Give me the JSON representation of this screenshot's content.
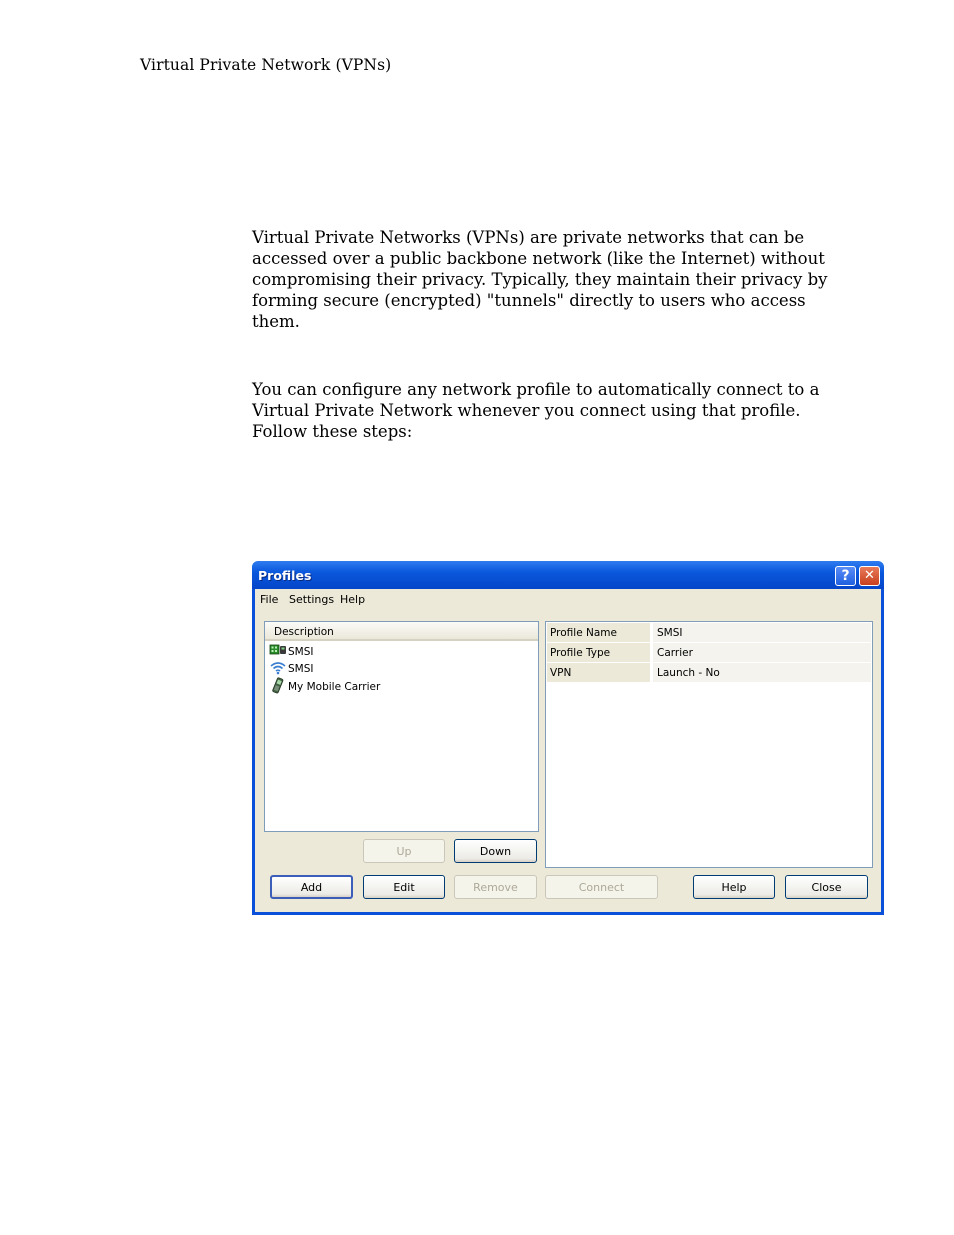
{
  "page": {
    "running_header": "Virtual Private Network (VPNs)",
    "paragraph_1": "Virtual Private Networks (VPNs) are private networks that can be accessed over a public backbone network (like the Internet) without compromising their privacy. Typically, they maintain their privacy by forming secure (encrypted) \"tunnels\" directly to users who access them.",
    "paragraph_2": "You can configure any network profile to automatically connect to a Virtual Private Network whenever you connect using that profile. Follow these steps:"
  },
  "dialog": {
    "title": "Profiles",
    "help_glyph": "?",
    "close_glyph": "✕",
    "menu": [
      "File",
      "Settings",
      "Help"
    ],
    "list": {
      "header": "Description",
      "items": [
        {
          "label": "SMSI",
          "icon": "modem-icon"
        },
        {
          "label": "SMSI",
          "icon": "wifi-icon"
        },
        {
          "label": "My Mobile Carrier",
          "icon": "mobile-phone-icon"
        }
      ]
    },
    "details": [
      {
        "key": "Profile Name",
        "value": "SMSI"
      },
      {
        "key": "Profile Type",
        "value": "Carrier"
      },
      {
        "key": "VPN",
        "value": "Launch - No"
      }
    ],
    "buttons": {
      "up": "Up",
      "down": "Down",
      "add": "Add",
      "edit": "Edit",
      "remove": "Remove",
      "connect": "Connect",
      "help": "Help",
      "close": "Close"
    },
    "colors": {
      "titlebar": "#0a58dd",
      "client": "#ece9d8",
      "border": "#0a50d8"
    }
  }
}
